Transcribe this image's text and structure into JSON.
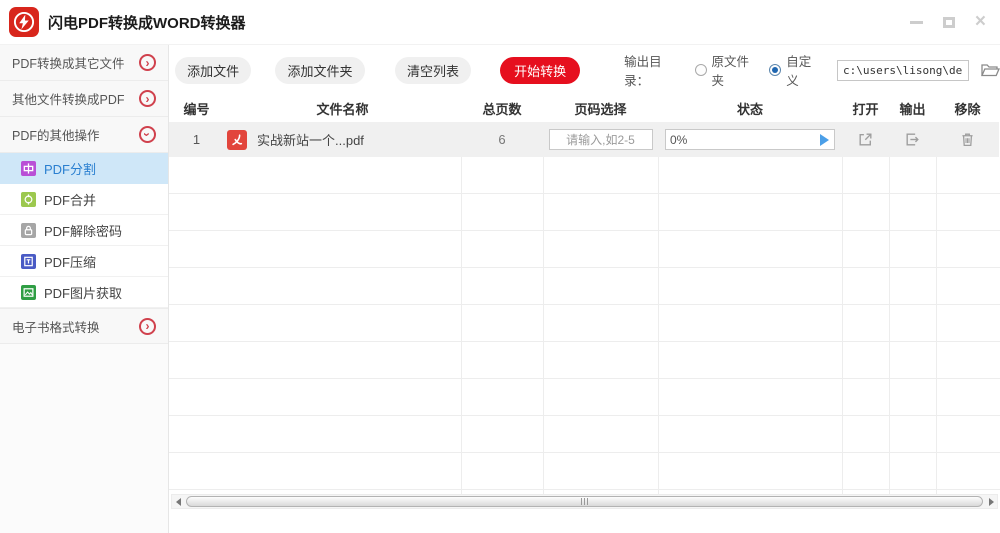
{
  "window": {
    "title": "闪电PDF转换成WORD转换器"
  },
  "sidebar": {
    "groups": [
      {
        "label": "PDF转换成其它文件",
        "state": "collapsed"
      },
      {
        "label": "其他文件转换成PDF",
        "state": "collapsed"
      },
      {
        "label": "PDF的其他操作",
        "state": "expanded"
      },
      {
        "label": "电子书格式转换",
        "state": "collapsed"
      }
    ],
    "sub_items": [
      {
        "label": "PDF分割",
        "icon": "pdf-split-icon",
        "color": "#b94fd6",
        "selected": true
      },
      {
        "label": "PDF合并",
        "icon": "pdf-merge-icon",
        "color": "#9cc84e",
        "selected": false
      },
      {
        "label": "PDF解除密码",
        "icon": "pdf-unlock-icon",
        "color": "#a6a6a6",
        "selected": false
      },
      {
        "label": "PDF压缩",
        "icon": "pdf-compress-icon",
        "color": "#4a5bc5",
        "selected": false
      },
      {
        "label": "PDF图片获取",
        "icon": "pdf-image-icon",
        "color": "#2f9e44",
        "selected": false
      }
    ]
  },
  "toolbar": {
    "add_file": "添加文件",
    "add_folder": "添加文件夹",
    "clear_list": "清空列表",
    "start_convert": "开始转换"
  },
  "output": {
    "label": "输出目录：",
    "radio_original": "原文件夹",
    "radio_custom": "自定义",
    "selected_option": "自定义",
    "path": "c:\\users\\lisong\\desktop"
  },
  "table": {
    "headers": [
      "编号",
      "文件名称",
      "总页数",
      "页码选择",
      "状态",
      "打开",
      "输出",
      "移除"
    ],
    "rows": [
      {
        "no": "1",
        "filename": "实战新站一个...pdf",
        "total_pages": "6",
        "page_select_placeholder": "请输入,如2-5",
        "progress": "0%"
      }
    ]
  },
  "colors": {
    "accent_red": "#e60f1e",
    "logo_red": "#d8261c",
    "selected_item_bg": "#cfe7f8",
    "selected_item_text": "#2a7fd0",
    "row_highlight": "#f0f0f0",
    "progress_play_blue": "#4b9fe8"
  }
}
